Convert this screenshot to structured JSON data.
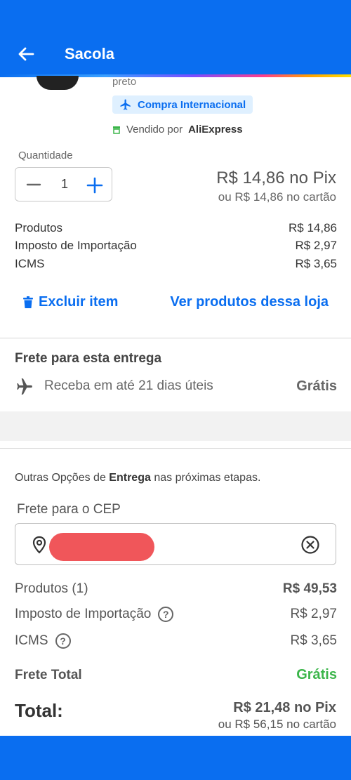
{
  "header": {
    "title": "Sacola",
    "back_icon": "arrow-left-icon",
    "color": "#0a6ef0"
  },
  "item": {
    "variant": "preto",
    "intl_badge": "Compra Internacional",
    "seller_prefix": "Vendido por",
    "seller_name": "AliExpress"
  },
  "quantity": {
    "label": "Quantidade",
    "value": "1"
  },
  "price": {
    "pix": "R$ 14,86 no Pix",
    "card": "ou R$ 14,86 no cartão"
  },
  "item_summary": [
    {
      "label": "Produtos",
      "value": "R$ 14,86"
    },
    {
      "label": "Imposto de Importação",
      "value": "R$ 2,97"
    },
    {
      "label": "ICMS",
      "value": "R$ 3,65"
    }
  ],
  "actions": {
    "delete": "Excluir item",
    "see_store": "Ver produtos dessa loja"
  },
  "shipping": {
    "title": "Frete para esta entrega",
    "delivery": "Receba em até 21 dias úteis",
    "price": "Grátis"
  },
  "other_options": {
    "prefix": "Outras Opções de",
    "bold": "Entrega",
    "suffix": "nas próximas etapas."
  },
  "cep": {
    "label": "Frete para o CEP"
  },
  "order_summary": {
    "products_label": "Produtos (1)",
    "products_value": "R$ 49,53",
    "import_label": "Imposto de Importação",
    "import_value": "R$ 2,97",
    "icms_label": "ICMS",
    "icms_value": "R$ 3,65",
    "freight_label": "Frete Total",
    "freight_value": "Grátis"
  },
  "total": {
    "label": "Total:",
    "pix": "R$ 21,48 no Pix",
    "card": "ou R$ 56,15 no cartão"
  },
  "colors": {
    "accent": "#0a6ef0",
    "free": "#3bb54a",
    "badge_bg": "#dff0ff"
  }
}
